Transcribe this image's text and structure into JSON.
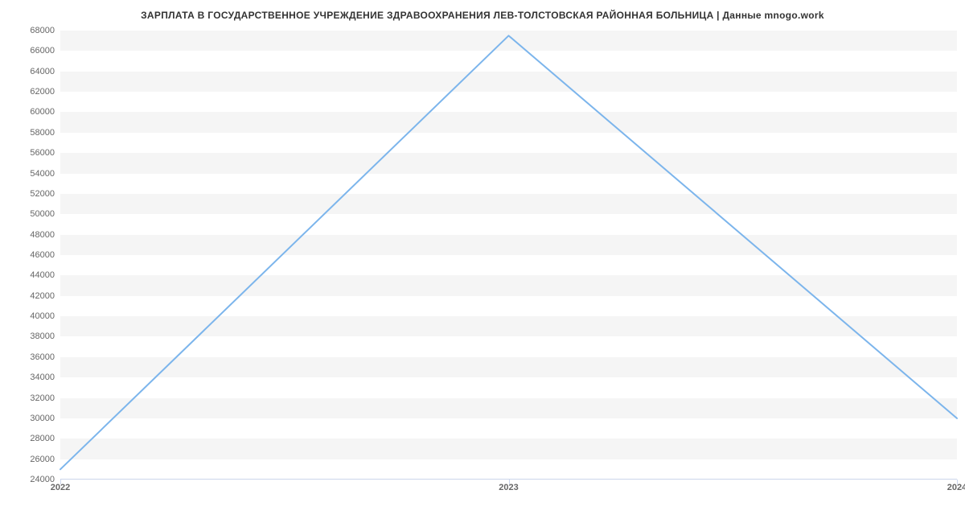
{
  "title": "ЗАРПЛАТА В ГОСУДАРСТВЕННОЕ УЧРЕЖДЕНИЕ ЗДРАВООХРАНЕНИЯ ЛЕВ-ТОЛСТОВСКАЯ РАЙОННАЯ БОЛЬНИЦА  | Данные mnogo.work",
  "chart_data": {
    "type": "line",
    "x": [
      2022,
      2023,
      2024
    ],
    "y": [
      25000,
      67500,
      30000
    ],
    "title": "ЗАРПЛАТА В ГОСУДАРСТВЕННОЕ УЧРЕЖДЕНИЕ ЗДРАВООХРАНЕНИЯ ЛЕВ-ТОЛСТОВСКАЯ РАЙОННАЯ БОЛЬНИЦА  | Данные mnogo.work",
    "xlabel": "",
    "ylabel": "",
    "y_ticks": [
      24000,
      26000,
      28000,
      30000,
      32000,
      34000,
      36000,
      38000,
      40000,
      42000,
      44000,
      46000,
      48000,
      50000,
      52000,
      54000,
      56000,
      58000,
      60000,
      62000,
      64000,
      66000,
      68000
    ],
    "x_ticks": [
      2022,
      2023,
      2024
    ],
    "ylim": [
      24000,
      68000
    ],
    "xlim": [
      2022,
      2024
    ]
  },
  "colors": {
    "line": "#7cb5ec",
    "band": "#f5f5f5"
  }
}
